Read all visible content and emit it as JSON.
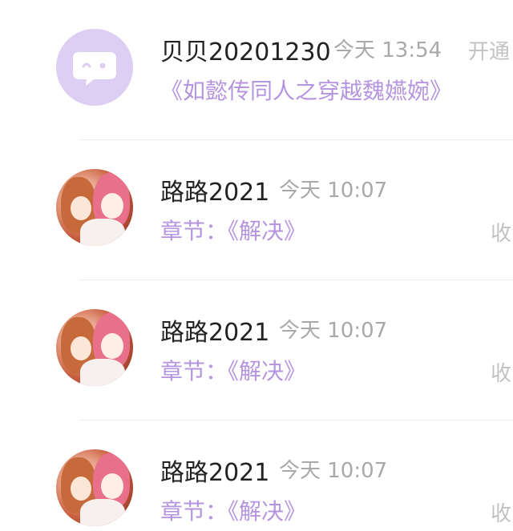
{
  "items": [
    {
      "name": "贝贝20201230",
      "time": "今天 13:54",
      "action": "开通",
      "sub": "《如懿传同人之穿越魏嬿婉》",
      "avatar": "chat-bubble-icon"
    },
    {
      "name": "路路2021",
      "time": "今天 10:07",
      "sub": "章节：《解决》",
      "action": "收",
      "avatar": "anime-avatar"
    },
    {
      "name": "路路2021",
      "time": "今天 10:07",
      "sub": "章节：《解决》",
      "action": "收",
      "avatar": "anime-avatar"
    },
    {
      "name": "路路2021",
      "time": "今天 10:07",
      "sub": "章节：《解决》",
      "action": "收",
      "avatar": "anime-avatar"
    }
  ],
  "colors": {
    "accent": "#b595df",
    "avatar_bg": "#dccff3",
    "name": "#222222",
    "time": "#a9a9a9",
    "action": "#c2c2c2"
  }
}
